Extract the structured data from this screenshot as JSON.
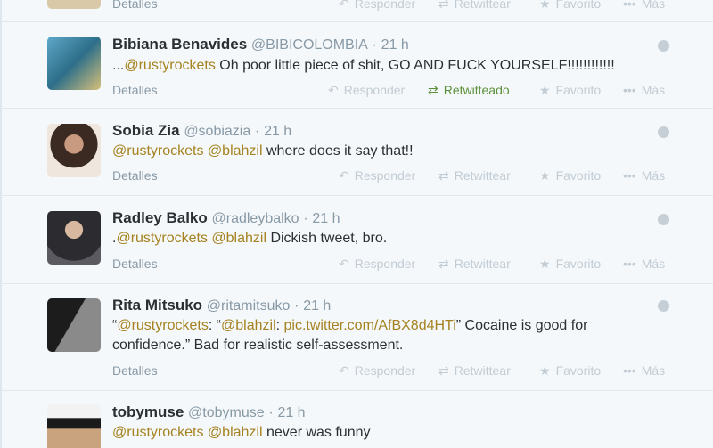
{
  "actions": {
    "details": "Detalles",
    "reply": "Responder",
    "retweet": "Retwittear",
    "retweeted": "Retwitteado",
    "favorite": "Favorito",
    "more": "Más"
  },
  "tweets": [
    {
      "name": "Bibiana Benavides",
      "handle": "@BIBICOLOMBIA",
      "dot": "·",
      "time": "21 h",
      "text_prefix": "...",
      "mention1": "@rustyrockets",
      "text_rest": " Oh poor little piece of shit, GO AND FUCK YOURSELF!!!!!!!!!!!!"
    },
    {
      "name": "Sobia Zia",
      "handle": "@sobiazia",
      "dot": "·",
      "time": "21 h",
      "mention1": "@rustyrockets",
      "mention2": "@blahzil",
      "text_rest": " where does it say that!!"
    },
    {
      "name": "Radley Balko",
      "handle": "@radleybalko",
      "dot": "·",
      "time": "21 h",
      "text_prefix": ".",
      "mention1": "@rustyrockets",
      "mention2": "@blahzil",
      "text_rest": " Dickish tweet, bro."
    },
    {
      "name": "Rita Mitsuko",
      "handle": "@ritamitsuko",
      "dot": "·",
      "time": "21 h",
      "q_open": "“",
      "mention1": "@rustyrockets",
      "sep1": ": “",
      "mention2": "@blahzil",
      "sep2": ": ",
      "link": "pic.twitter.com/AfBX8d4HTi",
      "text_rest": "” Cocaine is good for confidence.” Bad for realistic self-assessment."
    },
    {
      "name": "tobymuse",
      "handle": "@tobymuse",
      "dot": "·",
      "time": "21 h",
      "mention1": "@rustyrockets",
      "mention2": "@blahzil",
      "text_rest": " never was funny"
    }
  ],
  "colors": {
    "mention": "#a58220",
    "retweeted": "#5c913b",
    "muted": "#8899a6"
  }
}
